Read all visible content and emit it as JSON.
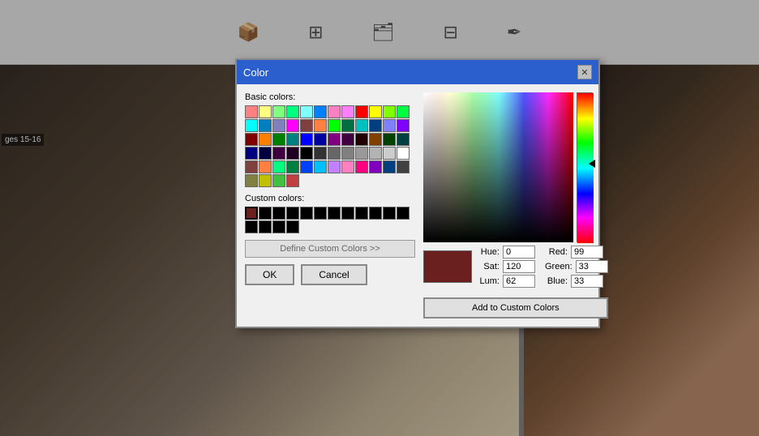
{
  "app": {
    "page_label": "ges 15-16"
  },
  "toolbar": {
    "icons": [
      {
        "name": "book-icon",
        "symbol": "📦"
      },
      {
        "name": "grid-icon",
        "symbol": "⊞"
      },
      {
        "name": "pages-icon",
        "symbol": "🗂"
      },
      {
        "name": "table-icon",
        "symbol": "⊟"
      },
      {
        "name": "stamp-icon",
        "symbol": "🖊"
      }
    ]
  },
  "dialog": {
    "title": "Color",
    "close_label": "✕",
    "basic_colors_label": "Basic colors:",
    "custom_colors_label": "Custom colors:",
    "define_btn_label": "Define Custom Colors >>",
    "ok_label": "OK",
    "cancel_label": "Cancel",
    "add_custom_label": "Add to Custom Colors",
    "hue_label": "Hue:",
    "sat_label": "Sat:",
    "lum_label": "Lum:",
    "red_label": "Red:",
    "green_label": "Green:",
    "blue_label": "Blue:",
    "hue_value": "0",
    "sat_value": "120",
    "lum_value": "62",
    "red_value": "99",
    "green_value": "33",
    "blue_value": "33"
  },
  "basic_colors": [
    "#ff8080",
    "#ffff80",
    "#80ff80",
    "#00ff80",
    "#80ffff",
    "#0080ff",
    "#ff80c0",
    "#ff80ff",
    "#ff0000",
    "#ffff00",
    "#80ff00",
    "#00ff40",
    "#00ffff",
    "#0080c0",
    "#8080c0",
    "#ff00ff",
    "#804040",
    "#ff8040",
    "#00ff00",
    "#007040",
    "#00c0c0",
    "#004080",
    "#8080ff",
    "#8000ff",
    "#800000",
    "#ff8000",
    "#008000",
    "#008080",
    "#0000ff",
    "#0000a0",
    "#800080",
    "#400040",
    "#200000",
    "#804000",
    "#004000",
    "#004040",
    "#000080",
    "#000040",
    "#400040",
    "#200020",
    "#000000",
    "#333333",
    "#666666",
    "#808080",
    "#999999",
    "#b3b3b3",
    "#cccccc",
    "#ffffff",
    "#804040",
    "#ff8040",
    "#00ff80",
    "#008040",
    "#0040ff",
    "#00c0ff",
    "#c080ff",
    "#ff80c0",
    "#ff0080",
    "#8000c0",
    "#004080",
    "#404040",
    "#808040",
    "#c0c000",
    "#40c040",
    "#c04040"
  ],
  "custom_colors": [
    "#6b2020",
    "#000000",
    "#000000",
    "#000000",
    "#000000",
    "#000000",
    "#000000",
    "#000000",
    "#000000",
    "#000000",
    "#000000",
    "#000000",
    "#000000",
    "#000000",
    "#000000",
    "#000000"
  ]
}
